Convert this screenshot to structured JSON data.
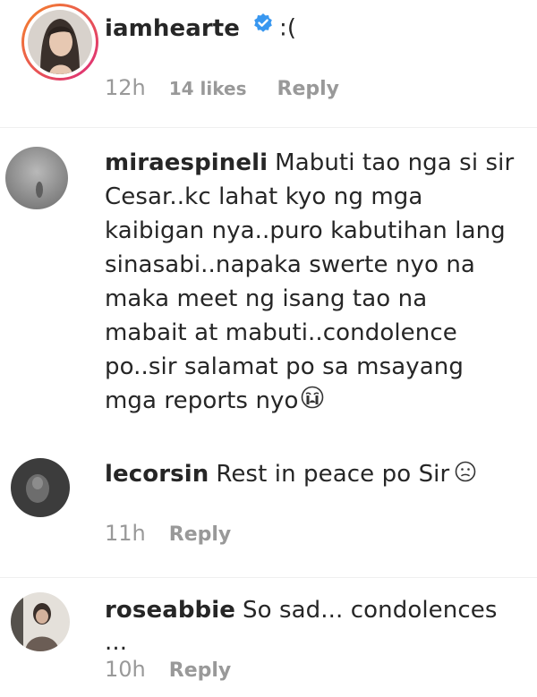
{
  "colors": {
    "text": "#262626",
    "meta": "#999999",
    "verified": "#3897f0",
    "story_ring_start": "#f58529",
    "story_ring_end": "#dd2a7b"
  },
  "comments": [
    {
      "username": "iamhearte",
      "verified": true,
      "avatar_icon": "profile-photo-woman",
      "text": ":(",
      "time": "12h",
      "likes": "14 likes",
      "reply_label": "Reply"
    },
    {
      "username": "miraespineli",
      "verified": false,
      "avatar_icon": "profile-photo-grey",
      "text_lines": [
        "Mabuti tao nga si sir",
        "Cesar..kc lahat kyo ng mga",
        "kaibigan nya..puro kabutihan lang",
        "sinasabi..napaka swerte nyo na",
        "maka meet ng isang tao na",
        "mabait at mabuti..condolence",
        "po..sir salamat po sa msayang",
        "mga reports nyo"
      ],
      "emoji": "crying-face-icon"
    },
    {
      "username": "lecorsin",
      "verified": false,
      "avatar_icon": "profile-photo-dark",
      "text": "Rest in peace po Sir",
      "emoji": "sad-face-icon",
      "time": "11h",
      "reply_label": "Reply"
    },
    {
      "username": "roseabbie",
      "verified": false,
      "avatar_icon": "profile-photo-person",
      "text": "So sad... condolences ...",
      "time": "10h",
      "reply_label": "Reply"
    }
  ]
}
